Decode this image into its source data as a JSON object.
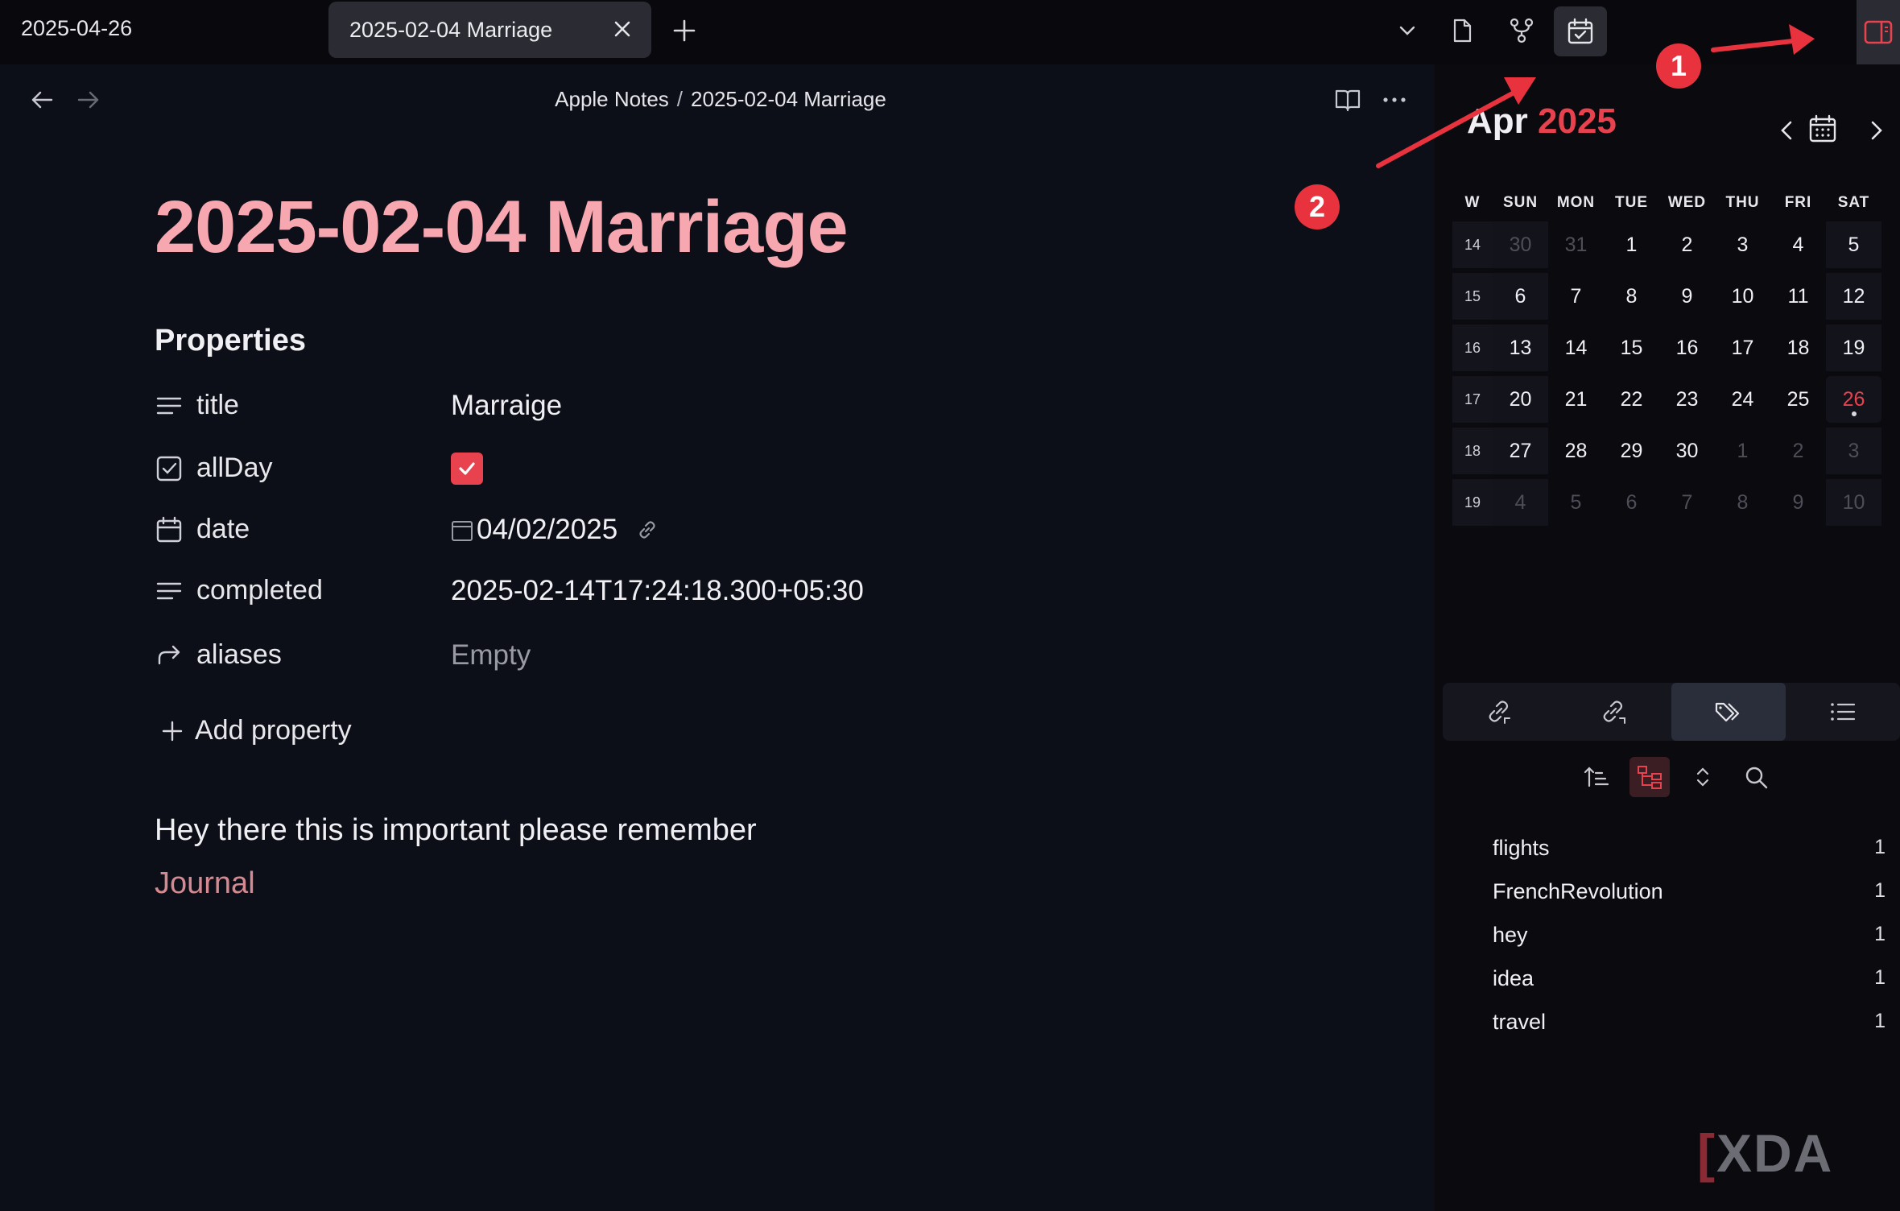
{
  "topbar": {
    "date": "2025-04-26",
    "tab_title": "2025-02-04 Marriage"
  },
  "editor": {
    "breadcrumb_folder": "Apple Notes",
    "breadcrumb_sep": "/",
    "breadcrumb_note": "2025-02-04 Marriage",
    "title": "2025-02-04 Marriage",
    "properties_heading": "Properties",
    "properties": [
      {
        "key": "title",
        "value": "Marraige",
        "icon": "text-lines-icon"
      },
      {
        "key": "allDay",
        "value": "checked",
        "icon": "checkbox-icon"
      },
      {
        "key": "date",
        "value": "04/02/2025",
        "icon": "calendar-icon"
      },
      {
        "key": "completed",
        "value": "2025-02-14T17:24:18.300+05:30",
        "icon": "text-lines-icon"
      },
      {
        "key": "aliases",
        "value": "Empty",
        "icon": "forward-arrow-icon"
      }
    ],
    "add_property": "Add property",
    "body_text": "Hey there this is important please remember",
    "body_link": "Journal"
  },
  "calendar": {
    "month": "Apr",
    "year": "2025",
    "headers": [
      "W",
      "SUN",
      "MON",
      "TUE",
      "WED",
      "THU",
      "FRI",
      "SAT"
    ],
    "weeks": [
      {
        "week": "14",
        "days": [
          "30",
          "31",
          "1",
          "2",
          "3",
          "4",
          "5"
        ]
      },
      {
        "week": "15",
        "days": [
          "6",
          "7",
          "8",
          "9",
          "10",
          "11",
          "12"
        ]
      },
      {
        "week": "16",
        "days": [
          "13",
          "14",
          "15",
          "16",
          "17",
          "18",
          "19"
        ]
      },
      {
        "week": "17",
        "days": [
          "20",
          "21",
          "22",
          "23",
          "24",
          "25",
          "26"
        ]
      },
      {
        "week": "18",
        "days": [
          "27",
          "28",
          "29",
          "30",
          "1",
          "2",
          "3"
        ]
      },
      {
        "week": "19",
        "days": [
          "4",
          "5",
          "6",
          "7",
          "8",
          "9",
          "10"
        ]
      }
    ],
    "today": "26",
    "accent_color": "#e8424f"
  },
  "tags": [
    {
      "name": "flights",
      "count": "1"
    },
    {
      "name": "FrenchRevolution",
      "count": "1"
    },
    {
      "name": "hey",
      "count": "1"
    },
    {
      "name": "idea",
      "count": "1"
    },
    {
      "name": "travel",
      "count": "1"
    }
  ],
  "annotations": {
    "badge_1": "1",
    "badge_2": "2",
    "color": "#e8333f"
  },
  "watermark": "XDA"
}
